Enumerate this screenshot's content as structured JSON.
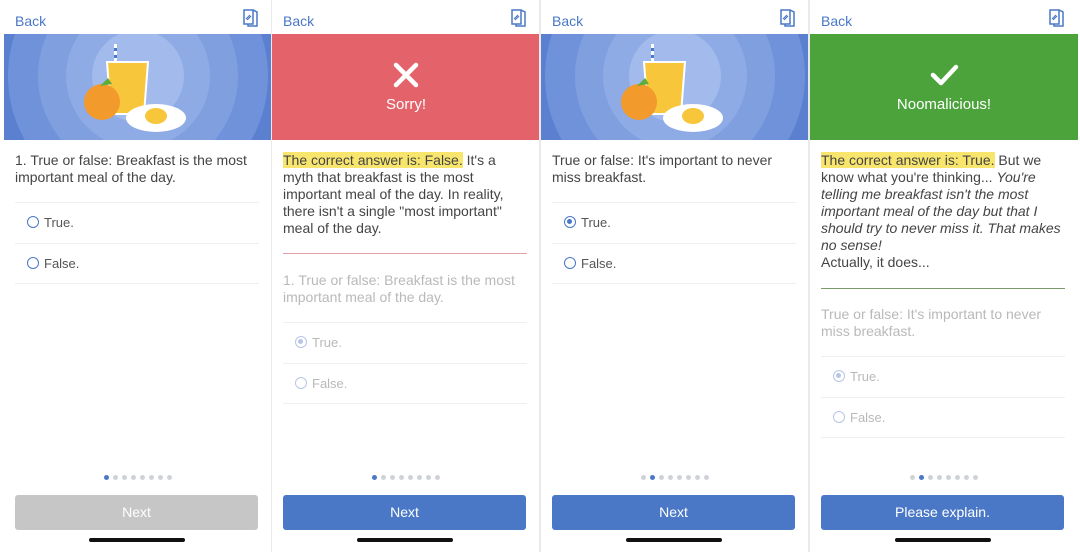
{
  "colors": {
    "accent": "#4a78c7",
    "hero_blue": "#5b80cf",
    "wrong_red": "#e4626a",
    "correct_green": "#4ca33c",
    "highlight": "#f7e56d",
    "disabled": "#c6c6c6"
  },
  "icons": {
    "top_right": "book-icon",
    "wrong": "x-mark-icon",
    "right": "check-mark-icon",
    "hero": "breakfast-illustration"
  },
  "screens": [
    {
      "back": "Back",
      "question": "1. True or false: Breakfast is the most important meal of the day.",
      "options": [
        {
          "label": "True.",
          "selected": false
        },
        {
          "label": "False.",
          "selected": false
        }
      ],
      "pager": {
        "total": 8,
        "active": 1
      },
      "button": {
        "label": "Next",
        "enabled": false
      }
    },
    {
      "back": "Back",
      "feedback": "Sorry!",
      "answer_highlight": "The correct answer is: False.",
      "answer_text": " It's a myth that breakfast is the most important meal of the day. In reality, there isn't a single \"most important\" meal of the day.",
      "question": "1. True or false: Breakfast is the most important meal of the day.",
      "options": [
        {
          "label": "True.",
          "selected": true
        },
        {
          "label": "False.",
          "selected": false
        }
      ],
      "pager": {
        "total": 8,
        "active": 1
      },
      "button": {
        "label": "Next",
        "enabled": true
      }
    },
    {
      "back": "Back",
      "question": "True or false: It's important to never miss breakfast.",
      "options": [
        {
          "label": "True.",
          "selected": true
        },
        {
          "label": "False.",
          "selected": false
        }
      ],
      "pager": {
        "total": 8,
        "active": 2
      },
      "button": {
        "label": "Next",
        "enabled": true
      }
    },
    {
      "back": "Back",
      "feedback": "Noomalicious!",
      "answer_highlight": "The correct answer is: True.",
      "answer_text": " But we know what you're thinking... ",
      "answer_italic": "You're telling me breakfast isn't the most important meal of the day but that I should try to never miss it. That makes no sense!",
      "answer_tail": "Actually, it does...",
      "question": "True or false: It's important to never miss breakfast.",
      "options": [
        {
          "label": "True.",
          "selected": true
        },
        {
          "label": "False.",
          "selected": false
        }
      ],
      "pager": {
        "total": 8,
        "active": 2
      },
      "button": {
        "label": "Please explain.",
        "enabled": true
      }
    }
  ]
}
